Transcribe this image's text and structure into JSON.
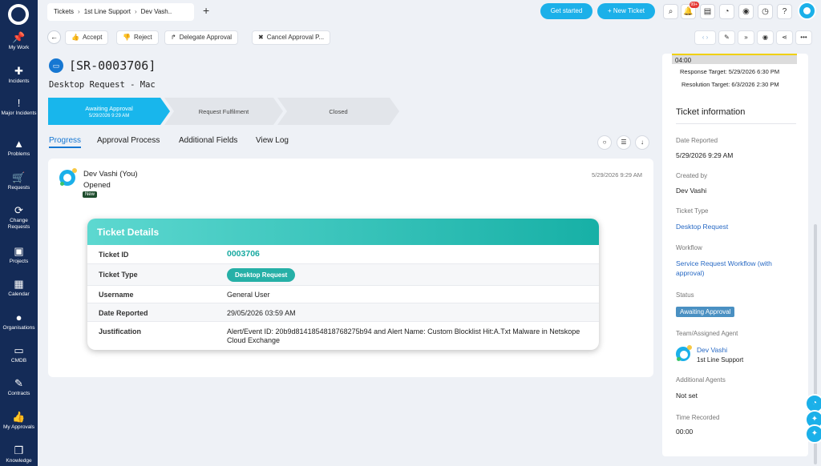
{
  "nav": [
    {
      "label": "My Work",
      "icon": "pin-icon"
    },
    {
      "label": "Incidents",
      "icon": "bandage-icon"
    },
    {
      "label": "Major Incidents",
      "icon": "exclamation-icon"
    },
    {
      "label": "Problems",
      "icon": "warning-icon"
    },
    {
      "label": "Requests",
      "icon": "cart-icon"
    },
    {
      "label": "Change Requests",
      "icon": "refresh-icon"
    },
    {
      "label": "Projects",
      "icon": "briefcase-icon"
    },
    {
      "label": "Calendar",
      "icon": "calendar-icon"
    },
    {
      "label": "Organisations",
      "icon": "person-icon"
    },
    {
      "label": "CMDB",
      "icon": "monitor-icon"
    },
    {
      "label": "Contracts",
      "icon": "contract-icon"
    },
    {
      "label": "My Approvals",
      "icon": "thumbs-up-icon"
    },
    {
      "label": "Knowledge",
      "icon": "book-icon"
    }
  ],
  "topbar": {
    "breadcrumb": [
      "Tickets",
      "1st Line Support",
      "Dev Vash.."
    ],
    "add_tab": "+",
    "get_started": "Get started",
    "new_ticket": "+ New Ticket",
    "notif_badge": "99+"
  },
  "actions": {
    "accept": "Accept",
    "reject": "Reject",
    "delegate": "Delegate Approval",
    "cancel": "Cancel Approval P..."
  },
  "ticket": {
    "id": "[SR-0003706]",
    "subtitle": "Desktop Request - Mac"
  },
  "stages": [
    {
      "label": "Awaiting Approval",
      "date": "5/29/2026 9:29 AM"
    },
    {
      "label": "Request Fulfilment",
      "date": ""
    },
    {
      "label": "Closed",
      "date": ""
    }
  ],
  "tabs": [
    "Progress",
    "Approval Process",
    "Additional Fields",
    "View Log"
  ],
  "activity": {
    "user": "Dev Vashi (You)",
    "action": "Opened",
    "tag": "New",
    "time": "5/29/2026 9:29 AM"
  },
  "details": {
    "title": "Ticket Details",
    "rows": [
      {
        "label": "Ticket ID",
        "value": "0003706"
      },
      {
        "label": "Ticket Type",
        "value": "Desktop Request"
      },
      {
        "label": "Username",
        "value": "General User"
      },
      {
        "label": "Date Reported",
        "value": "29/05/2026 03:59 AM"
      },
      {
        "label": "Justification",
        "value": "Alert/Event ID: 20b9d8141854818768275b94 and Alert Name: Custom Blocklist Hit:A.Txt Malware in Netskope Cloud Exchange"
      }
    ]
  },
  "right_panel": {
    "time_left": "04:00",
    "response_target": "Response Target: 5/29/2026 6:30 PM",
    "resolution_target": "Resolution Target: 6/3/2026 2:30 PM",
    "heading": "Ticket information",
    "date_reported_label": "Date Reported",
    "date_reported": "5/29/2026 9:29 AM",
    "created_by_label": "Created by",
    "created_by": "Dev Vashi",
    "ticket_type_label": "Ticket Type",
    "ticket_type": "Desktop Request",
    "workflow_label": "Workflow",
    "workflow": "Service Request Workflow (with approval)",
    "status_label": "Status",
    "status": "Awaiting Approval",
    "team_label": "Team/Assigned Agent",
    "agent_name": "Dev Vashi",
    "agent_team": "1st Line Support",
    "additional_agents_label": "Additional Agents",
    "additional_agents": "Not set",
    "time_recorded_label": "Time Recorded",
    "time_recorded": "00:00"
  },
  "colors": {
    "sidebar": "#142b57",
    "accent": "#1bb0e9",
    "teal": "#17b0a6",
    "link": "#1677d2"
  }
}
